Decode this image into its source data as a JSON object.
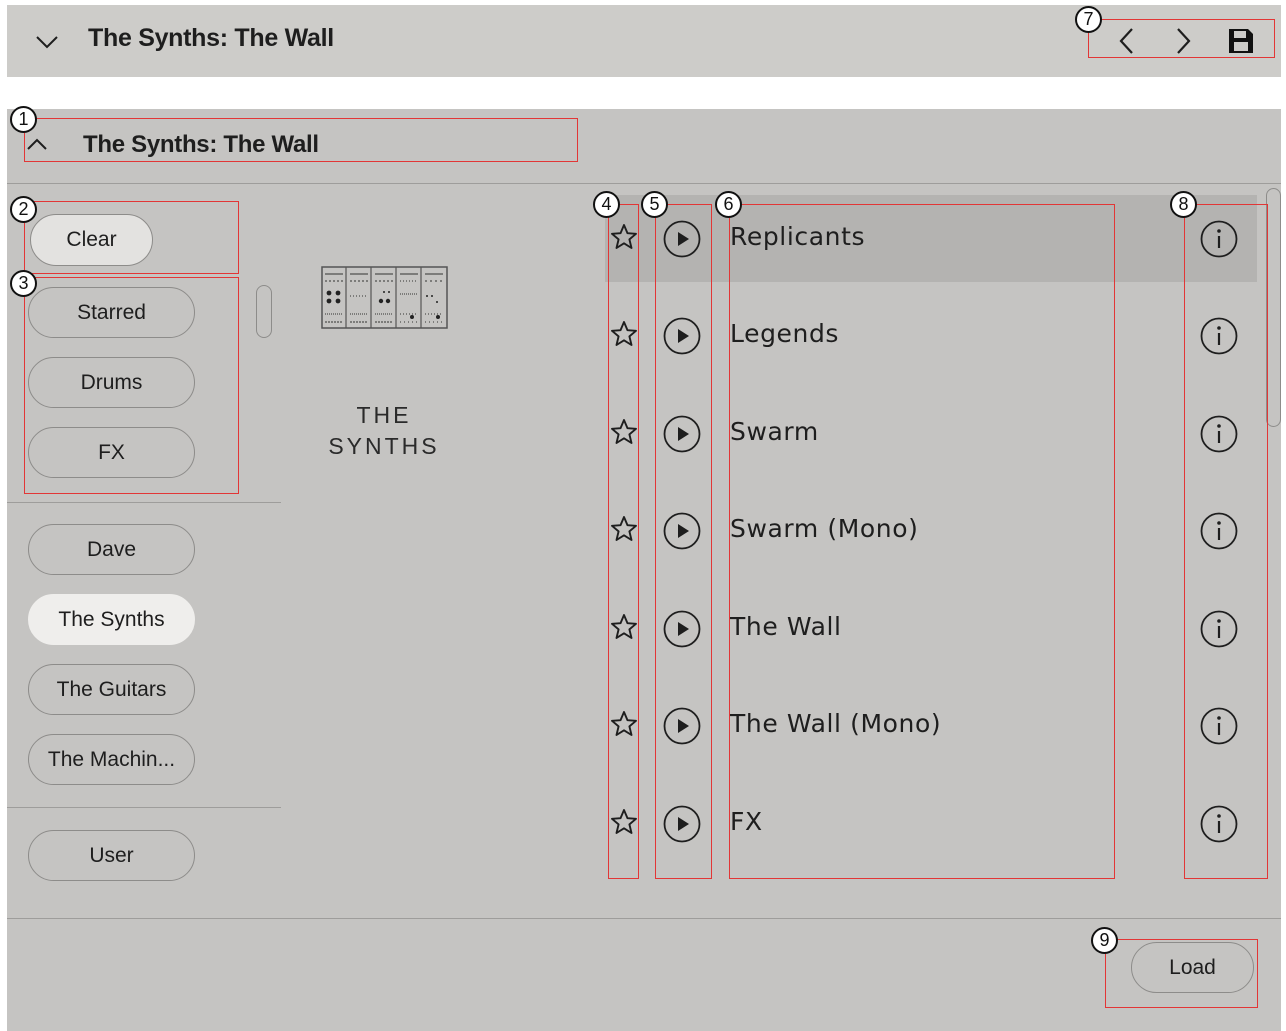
{
  "header": {
    "title": "The Synths: The Wall",
    "back_label": "previous-preset",
    "forward_label": "next-preset"
  },
  "panel": {
    "title": "The Synths: The Wall",
    "clear_label": "Clear",
    "filters": [
      "Starred",
      "Drums",
      "FX"
    ],
    "libraries": [
      "Dave",
      "The Synths",
      "The Guitars",
      "The Machin..."
    ],
    "active_library": "The Synths",
    "user_label": "User",
    "brand_line1": "THE",
    "brand_line2": "SYNTHS",
    "presets": [
      "Replicants",
      "Legends",
      "Swarm",
      "Swarm (Mono)",
      "The Wall",
      "The Wall (Mono)",
      "FX"
    ],
    "selected_preset": "Replicants",
    "load_label": "Load"
  },
  "annotations": [
    "1",
    "2",
    "3",
    "4",
    "5",
    "6",
    "7",
    "8",
    "9"
  ],
  "colors": {
    "panel_bg": "#c5c4c2",
    "topbar_bg": "#cdccc9",
    "selected_row": "#b4b3b1",
    "active_pill": "#efeeec",
    "annotation_red": "#e23636"
  },
  "icons": {
    "collapse": "chevron-down-icon",
    "expand": "chevron-up-icon",
    "back": "chevron-left-icon",
    "forward": "chevron-right-icon",
    "save": "save-icon",
    "star": "star-icon",
    "play": "play-icon",
    "info": "info-icon"
  }
}
